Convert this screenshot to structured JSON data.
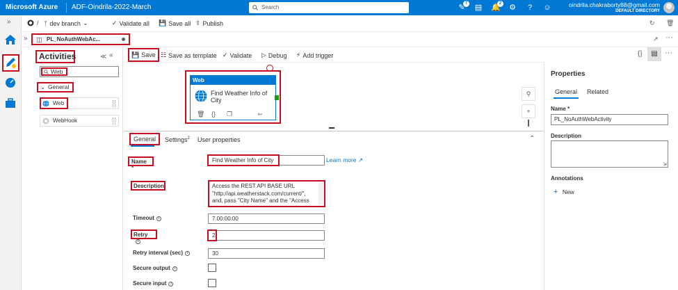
{
  "topbar": {
    "brand": "Microsoft Azure",
    "factory": "ADF-Oindrila-2022-March",
    "search_placeholder": "Search",
    "notifications_count_1": "7",
    "notifications_count_2": "2",
    "user_email": "oindrila.chakraborty88@gmail.com",
    "user_directory": "DEFAULT DIRECTORY"
  },
  "toolbar": {
    "branch": "dev branch",
    "validate_all": "Validate all",
    "save_all": "Save all",
    "publish": "Publish"
  },
  "pipeline_tab": {
    "label": "PL_NoAuthWebAc..."
  },
  "activities": {
    "title": "Activities",
    "search_value": "Web",
    "group": "General",
    "items": [
      "Web",
      "WebHook"
    ]
  },
  "canvas_toolbar": {
    "save": "Save",
    "save_as_template": "Save as template",
    "validate": "Validate",
    "debug": "Debug",
    "add_trigger": "Add trigger"
  },
  "web_node": {
    "type": "Web",
    "name": "Find Weather Info of City"
  },
  "details": {
    "tabs": {
      "general": "General",
      "settings": "Settings",
      "settings_badge": "2",
      "user_properties": "User properties"
    },
    "name_label": "Name",
    "name_required": "*",
    "name_value": "Find Weather Info of City",
    "learn_more": "Learn more",
    "description_label": "Description",
    "description_value": "Access the REST API BASE URL \"http://api.weatherstack.com/current/\", and, pass \"City Name\" and the \"Access",
    "timeout_label": "Timeout",
    "timeout_value": "7.00:00:00",
    "retry_label": "Retry",
    "retry_value": "2",
    "retry_interval_label": "Retry interval (sec)",
    "retry_interval_value": "30",
    "secure_output_label": "Secure output",
    "secure_input_label": "Secure input"
  },
  "properties": {
    "title": "Properties",
    "tab_general": "General",
    "tab_related": "Related",
    "name_label": "Name *",
    "name_value": "PL_NoAuthWebActivity",
    "description_label": "Description",
    "annotations_label": "Annotations",
    "new_label": "New"
  },
  "colors": {
    "azure_blue": "#0078d4",
    "highlight_red": "#c50f1f"
  }
}
